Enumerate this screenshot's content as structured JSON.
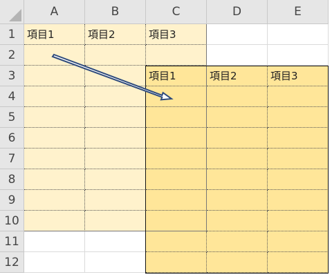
{
  "columns": [
    "A",
    "B",
    "C",
    "D",
    "E"
  ],
  "rows": [
    "1",
    "2",
    "3",
    "4",
    "5",
    "6",
    "7",
    "8",
    "9",
    "10",
    "11",
    "12"
  ],
  "source_headers": [
    "項目1",
    "項目2",
    "項目3"
  ],
  "dest_headers": [
    "項目1",
    "項目2",
    "項目3"
  ],
  "colors": {
    "source_fill": "#fff2cc",
    "dest_fill": "#ffe699",
    "arrow": "#2f4b7c",
    "header_bg": "#e6e6e6"
  }
}
